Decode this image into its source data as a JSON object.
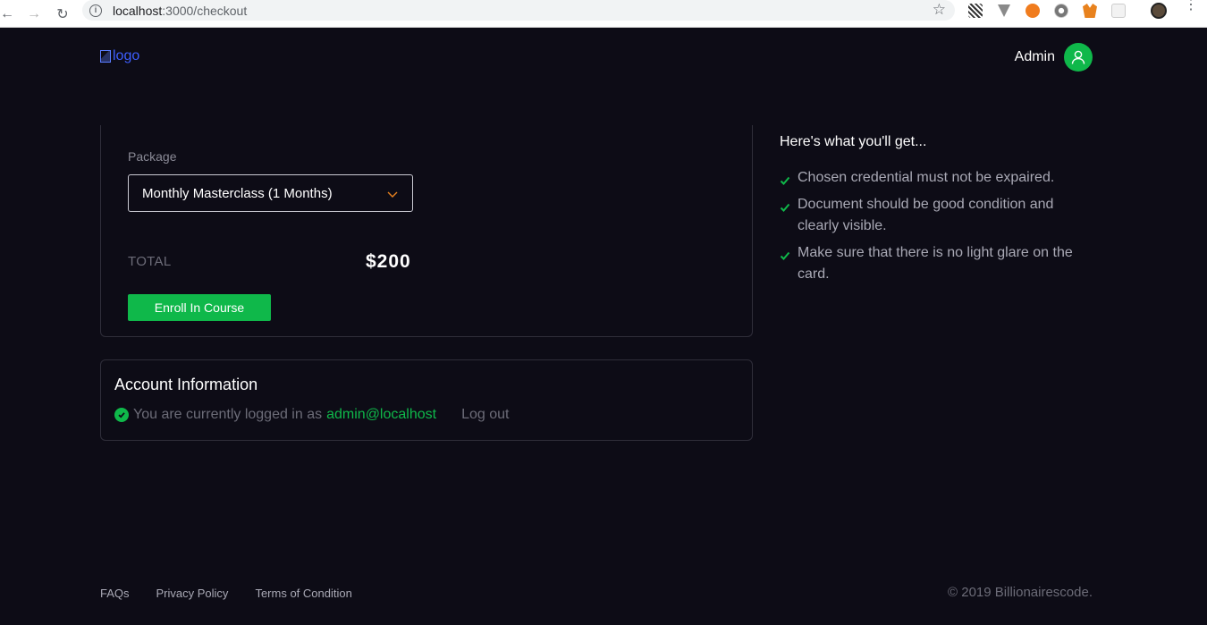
{
  "browser": {
    "url_host": "localhost",
    "url_path": ":3000/checkout"
  },
  "header": {
    "logo_alt": "logo",
    "admin_name": "Admin"
  },
  "package_card": {
    "label": "Package",
    "selected_package": "Monthly Masterclass (1 Months)",
    "total_label": "TOTAL",
    "total_value": "$200",
    "enroll_button": "Enroll In Course"
  },
  "account_card": {
    "title": "Account Information",
    "logged_in_text": "You are currently logged in as",
    "email": "admin@localhost",
    "logout": "Log out"
  },
  "benefits": {
    "title": "Here's what you'll get...",
    "items": [
      "Chosen credential must not be expaired.",
      "Document should be good condition and clearly visible.",
      "Make sure that there is no light glare on the card."
    ]
  },
  "footer": {
    "links": [
      "FAQs",
      "Privacy Policy",
      "Terms of Condition"
    ],
    "copyright": "© 2019 Billionairescode."
  },
  "colors": {
    "background": "#0d0c16",
    "accent_green": "#0fb84a",
    "chevron_orange": "#e8821e",
    "muted_text": "#6c6c78"
  }
}
